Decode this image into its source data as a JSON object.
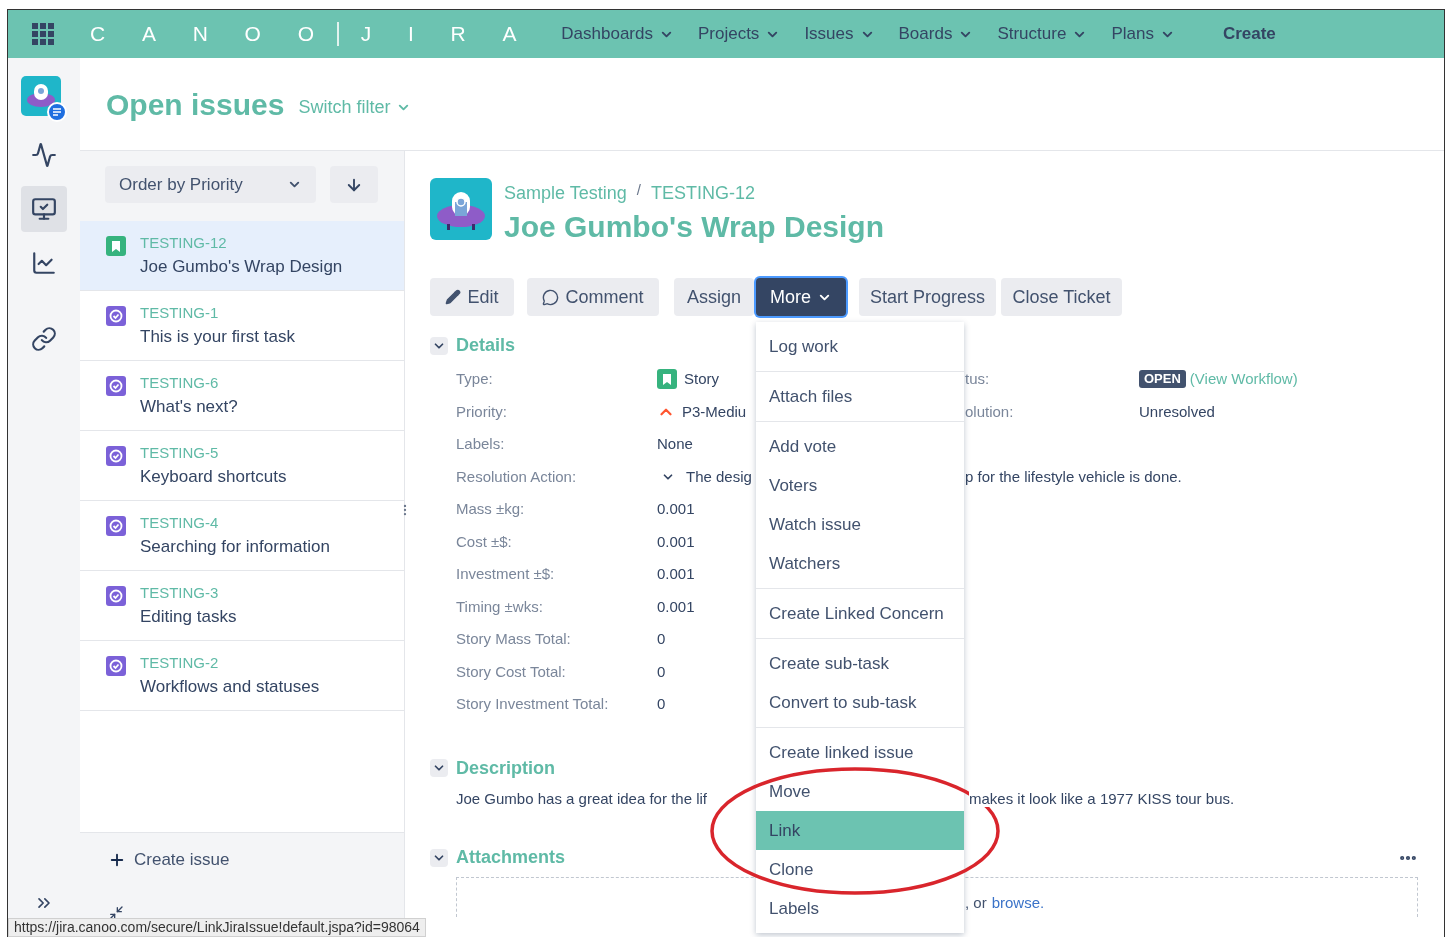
{
  "nav": {
    "logo_left": "CANOO",
    "logo_right": "JIRA",
    "items": [
      {
        "label": "Dashboards"
      },
      {
        "label": "Projects"
      },
      {
        "label": "Issues"
      },
      {
        "label": "Boards"
      },
      {
        "label": "Structure"
      },
      {
        "label": "Plans"
      }
    ],
    "create": "Create"
  },
  "rail": {
    "items": [
      {
        "kind": "activity",
        "selected": false
      },
      {
        "kind": "board",
        "selected": true
      },
      {
        "kind": "chart",
        "selected": false
      },
      {
        "kind": "link",
        "selected": false
      }
    ]
  },
  "header": {
    "title": "Open issues",
    "switch_filter": "Switch filter"
  },
  "issue_list": {
    "order": "Order by Priority",
    "create": "Create issue",
    "issues": [
      {
        "key": "TESTING-12",
        "summary": "Joe Gumbo's Wrap Design",
        "kind": "story",
        "selected": true
      },
      {
        "key": "TESTING-1",
        "summary": "This is your first task",
        "kind": "task",
        "selected": false
      },
      {
        "key": "TESTING-6",
        "summary": "What's next?",
        "kind": "task",
        "selected": false
      },
      {
        "key": "TESTING-5",
        "summary": "Keyboard shortcuts",
        "kind": "task",
        "selected": false
      },
      {
        "key": "TESTING-4",
        "summary": "Searching for information",
        "kind": "task",
        "selected": false
      },
      {
        "key": "TESTING-3",
        "summary": "Editing tasks",
        "kind": "task",
        "selected": false
      },
      {
        "key": "TESTING-2",
        "summary": "Workflows and statuses",
        "kind": "task",
        "selected": false
      }
    ]
  },
  "issue": {
    "project": "Sample Testing",
    "separator": "/",
    "key": "TESTING-12",
    "title": "Joe Gumbo's Wrap Design",
    "actions": [
      {
        "label": "Edit",
        "kind": "edit",
        "active": false
      },
      {
        "label": "Comment",
        "kind": "comment",
        "active": false
      },
      {
        "label": "Assign",
        "kind": "plain",
        "active": false
      },
      {
        "label": "More",
        "kind": "dropdown",
        "active": true
      },
      {
        "label": "Start Progress",
        "kind": "plain",
        "active": false
      },
      {
        "label": "Close Ticket",
        "kind": "plain",
        "active": false
      }
    ]
  },
  "more_menu": {
    "groups": [
      {
        "items": [
          {
            "label": "Log work",
            "selected": false
          }
        ]
      },
      {
        "items": [
          {
            "label": "Attach files",
            "selected": false
          }
        ]
      },
      {
        "items": [
          {
            "label": "Add vote",
            "selected": false
          },
          {
            "label": "Voters",
            "selected": false
          },
          {
            "label": "Watch issue",
            "selected": false
          },
          {
            "label": "Watchers",
            "selected": false
          }
        ]
      },
      {
        "items": [
          {
            "label": "Create Linked Concern",
            "selected": false
          }
        ]
      },
      {
        "items": [
          {
            "label": "Create sub-task",
            "selected": false
          },
          {
            "label": "Convert to sub-task",
            "selected": false
          }
        ]
      },
      {
        "items": [
          {
            "label": "Create linked issue",
            "selected": false
          },
          {
            "label": "Move",
            "selected": false
          },
          {
            "label": "Link",
            "selected": true
          },
          {
            "label": "Clone",
            "selected": false
          },
          {
            "label": "Labels",
            "selected": false
          }
        ]
      }
    ]
  },
  "details": {
    "title": "Details",
    "expanded": true,
    "fields": [
      {
        "label": "Type:",
        "kind": "type",
        "value": "Story"
      },
      {
        "label": "Priority:",
        "kind": "priority",
        "value": "P3-Mediu"
      },
      {
        "label": "Labels:",
        "kind": "plain",
        "value": "None"
      },
      {
        "label": "Resolution Action:",
        "kind": "expand",
        "value": "The desig",
        "continuation": "p for the lifestyle vehicle is done."
      },
      {
        "label": "Mass ±kg:",
        "kind": "plain",
        "value": "0.001"
      },
      {
        "label": "Cost ±$:",
        "kind": "plain",
        "value": "0.001"
      },
      {
        "label": "Investment ±$:",
        "kind": "plain",
        "value": "0.001"
      },
      {
        "label": "Timing ±wks:",
        "kind": "plain",
        "value": "0.001"
      },
      {
        "label": "Story Mass Total:",
        "kind": "plain",
        "value": "0"
      },
      {
        "label": "Story Cost Total:",
        "kind": "plain",
        "value": "0"
      },
      {
        "label": "Story Investment Total:",
        "kind": "plain",
        "value": "0"
      }
    ],
    "side_fields": [
      {
        "label": "tus:",
        "kind": "status",
        "badge": "OPEN",
        "link": "(View Workflow)"
      },
      {
        "label": "olution:",
        "kind": "plain",
        "value": "Unresolved"
      }
    ]
  },
  "description": {
    "title": "Description",
    "expanded": true,
    "text_left": "Joe Gumbo has a great idea for the lif",
    "text_right": "makes it look like a 1977 KISS tour bus."
  },
  "attachments": {
    "title": "Attachments",
    "expanded": true,
    "drop_text": ", or",
    "browse": "browse."
  },
  "status_bar": {
    "url": "https://jira.canoo.com/secure/LinkJiraIssue!default.jspa?id=98064"
  }
}
